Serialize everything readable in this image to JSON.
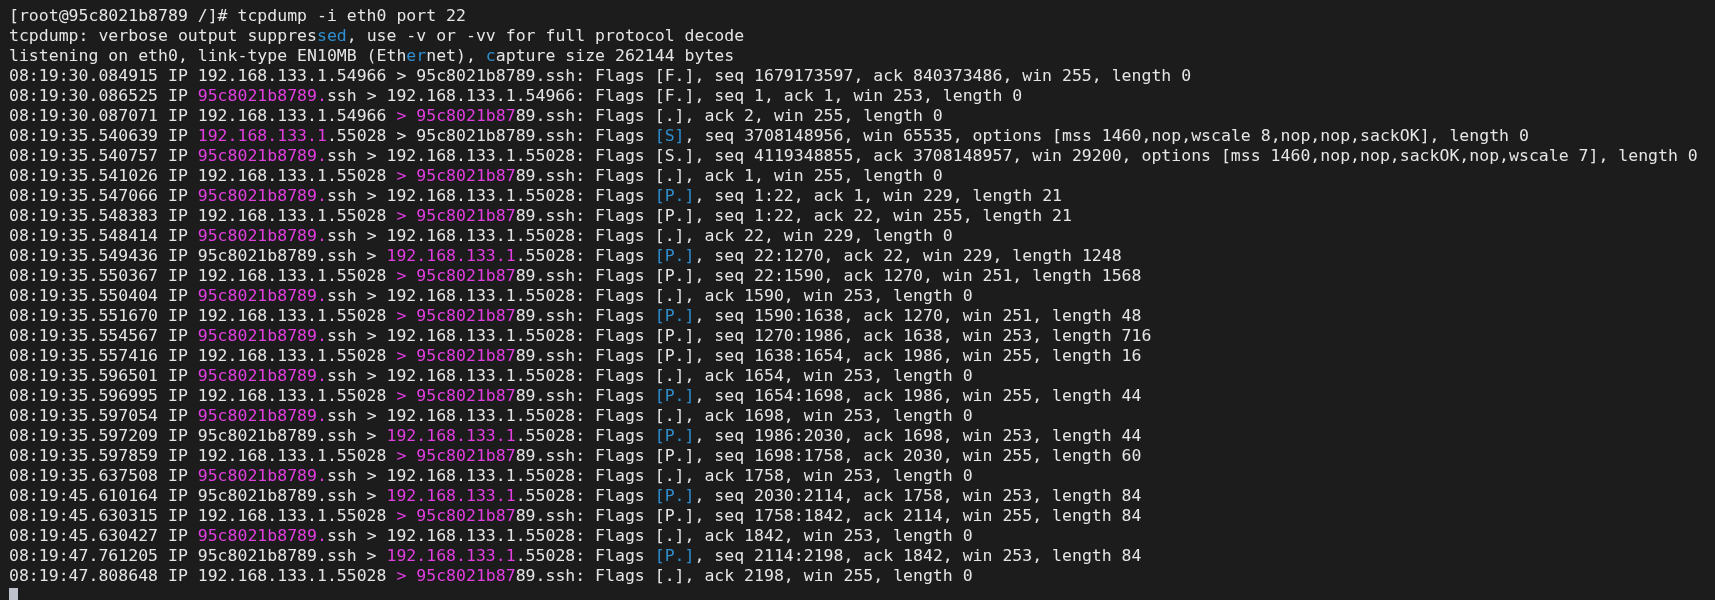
{
  "terminal": {
    "lines": [
      {
        "segments": [
          {
            "kind": "plain",
            "text": "[root@95c8021b8789 /]# tcpdump -i eth0 port 22"
          }
        ]
      },
      {
        "segments": [
          {
            "kind": "plain",
            "text": "tcpdump: verbose output suppres"
          },
          {
            "kind": "flag",
            "text": "sed"
          },
          {
            "kind": "plain",
            "text": ", use -v or -vv for full protocol decode"
          }
        ]
      },
      {
        "segments": [
          {
            "kind": "plain",
            "text": "listening on eth0, link-type EN10MB (Eth"
          },
          {
            "kind": "flag",
            "text": "er"
          },
          {
            "kind": "plain",
            "text": "net), "
          },
          {
            "kind": "flag",
            "text": "c"
          },
          {
            "kind": "plain",
            "text": "apture size 262144 bytes"
          }
        ]
      },
      {
        "segments": [
          {
            "kind": "plain",
            "text": "08:19:30.084915 IP 192.168.133.1.54966 > 95c8021b8789.ssh: Flags [F.], seq 1679173597, ack 840373486, win 255, length 0"
          }
        ]
      },
      {
        "segments": [
          {
            "kind": "plain",
            "text": "08:19:30.086525 IP "
          },
          {
            "kind": "match",
            "text": "95c8021b8789."
          },
          {
            "kind": "plain",
            "text": "ssh > 192.168.133.1.54966: Flags [F.], seq 1, ack 1, win 253, length 0"
          }
        ]
      },
      {
        "segments": [
          {
            "kind": "plain",
            "text": "08:19:30.087071 IP 192.168.133.1.54966 "
          },
          {
            "kind": "match",
            "text": "> 95c8021b87"
          },
          {
            "kind": "plain",
            "text": "89.ssh: Flags [.], ack 2, win 255, length 0"
          }
        ]
      },
      {
        "segments": [
          {
            "kind": "plain",
            "text": "08:19:35.540639 IP "
          },
          {
            "kind": "match",
            "text": "192.168.133.1"
          },
          {
            "kind": "plain",
            "text": ".55028 > 95c8021b8789.ssh: Flags "
          },
          {
            "kind": "flag",
            "text": "[S]"
          },
          {
            "kind": "plain",
            "text": ", seq 3708148956, win 65535, options [mss 1460,nop,wscale 8,nop,nop,sackOK], length 0"
          }
        ]
      },
      {
        "segments": [
          {
            "kind": "plain",
            "text": "08:19:35.540757 IP "
          },
          {
            "kind": "match",
            "text": "95c8021b8789."
          },
          {
            "kind": "plain",
            "text": "ssh > 192.168.133.1.55028: Flags [S.], seq 4119348855, ack 3708148957, win 29200, options [mss 1460,nop,nop,sackOK,nop,wscale 7], length 0"
          }
        ]
      },
      {
        "segments": [
          {
            "kind": "plain",
            "text": "08:19:35.541026 IP 192.168.133.1.55028 "
          },
          {
            "kind": "match",
            "text": "> 95c8021b87"
          },
          {
            "kind": "plain",
            "text": "89.ssh: Flags [.], ack 1, win 255, length 0"
          }
        ]
      },
      {
        "segments": [
          {
            "kind": "plain",
            "text": "08:19:35.547066 IP "
          },
          {
            "kind": "match",
            "text": "95c8021b8789."
          },
          {
            "kind": "plain",
            "text": "ssh > 192.168.133.1.55028: Flags "
          },
          {
            "kind": "flag",
            "text": "[P.]"
          },
          {
            "kind": "plain",
            "text": ", seq 1:22, ack 1, win 229, length 21"
          }
        ]
      },
      {
        "segments": [
          {
            "kind": "plain",
            "text": "08:19:35.548383 IP 192.168.133.1.55028 "
          },
          {
            "kind": "match",
            "text": "> 95c8021b87"
          },
          {
            "kind": "plain",
            "text": "89.ssh: Flags [P.], seq 1:22, ack 22, win 255, length 21"
          }
        ]
      },
      {
        "segments": [
          {
            "kind": "plain",
            "text": "08:19:35.548414 IP "
          },
          {
            "kind": "match",
            "text": "95c8021b8789."
          },
          {
            "kind": "plain",
            "text": "ssh > 192.168.133.1.55028: Flags [.], ack 22, win 229, length 0"
          }
        ]
      },
      {
        "segments": [
          {
            "kind": "plain",
            "text": "08:19:35.549436 IP 95c8021b8789.ssh > "
          },
          {
            "kind": "match",
            "text": "192.168.133.1"
          },
          {
            "kind": "plain",
            "text": ".55028: Flags "
          },
          {
            "kind": "flag",
            "text": "[P.]"
          },
          {
            "kind": "plain",
            "text": ", seq 22:1270, ack 22, win 229, length 1248"
          }
        ]
      },
      {
        "segments": [
          {
            "kind": "plain",
            "text": "08:19:35.550367 IP 192.168.133.1.55028 "
          },
          {
            "kind": "match",
            "text": "> 95c8021b87"
          },
          {
            "kind": "plain",
            "text": "89.ssh: Flags [P.], seq 22:1590, ack 1270, win 251, length 1568"
          }
        ]
      },
      {
        "segments": [
          {
            "kind": "plain",
            "text": "08:19:35.550404 IP "
          },
          {
            "kind": "match",
            "text": "95c8021b8789."
          },
          {
            "kind": "plain",
            "text": "ssh > 192.168.133.1.55028: Flags [.], ack 1590, win 253, length 0"
          }
        ]
      },
      {
        "segments": [
          {
            "kind": "plain",
            "text": "08:19:35.551670 IP 192.168.133.1.55028 "
          },
          {
            "kind": "match",
            "text": "> 95c8021b87"
          },
          {
            "kind": "plain",
            "text": "89.ssh: Flags "
          },
          {
            "kind": "flag",
            "text": "[P.]"
          },
          {
            "kind": "plain",
            "text": ", seq 1590:1638, ack 1270, win 251, length 48"
          }
        ]
      },
      {
        "segments": [
          {
            "kind": "plain",
            "text": "08:19:35.554567 IP "
          },
          {
            "kind": "match",
            "text": "95c8021b8789."
          },
          {
            "kind": "plain",
            "text": "ssh > 192.168.133.1.55028: Flags [P.], seq 1270:1986, ack 1638, win 253, length 716"
          }
        ]
      },
      {
        "segments": [
          {
            "kind": "plain",
            "text": "08:19:35.557416 IP 192.168.133.1.55028 "
          },
          {
            "kind": "match",
            "text": "> 95c8021b87"
          },
          {
            "kind": "plain",
            "text": "89.ssh: Flags [P.], seq 1638:1654, ack 1986, win 255, length 16"
          }
        ]
      },
      {
        "segments": [
          {
            "kind": "plain",
            "text": "08:19:35.596501 IP "
          },
          {
            "kind": "match",
            "text": "95c8021b8789."
          },
          {
            "kind": "plain",
            "text": "ssh > 192.168.133.1.55028: Flags [.], ack 1654, win 253, length 0"
          }
        ]
      },
      {
        "segments": [
          {
            "kind": "plain",
            "text": "08:19:35.596995 IP 192.168.133.1.55028 "
          },
          {
            "kind": "match",
            "text": "> 95c8021b87"
          },
          {
            "kind": "plain",
            "text": "89.ssh: Flags "
          },
          {
            "kind": "flag",
            "text": "[P.]"
          },
          {
            "kind": "plain",
            "text": ", seq 1654:1698, ack 1986, win 255, length 44"
          }
        ]
      },
      {
        "segments": [
          {
            "kind": "plain",
            "text": "08:19:35.597054 IP "
          },
          {
            "kind": "match",
            "text": "95c8021b8789."
          },
          {
            "kind": "plain",
            "text": "ssh > 192.168.133.1.55028: Flags [.], ack 1698, win 253, length 0"
          }
        ]
      },
      {
        "segments": [
          {
            "kind": "plain",
            "text": "08:19:35.597209 IP 95c8021b8789.ssh > "
          },
          {
            "kind": "match",
            "text": "192.168.133.1"
          },
          {
            "kind": "plain",
            "text": ".55028: Flags "
          },
          {
            "kind": "flag",
            "text": "[P.]"
          },
          {
            "kind": "plain",
            "text": ", seq 1986:2030, ack 1698, win 253, length 44"
          }
        ]
      },
      {
        "segments": [
          {
            "kind": "plain",
            "text": "08:19:35.597859 IP 192.168.133.1.55028 "
          },
          {
            "kind": "match",
            "text": "> 95c8021b87"
          },
          {
            "kind": "plain",
            "text": "89.ssh: Flags [P.], seq 1698:1758, ack 2030, win 255, length 60"
          }
        ]
      },
      {
        "segments": [
          {
            "kind": "plain",
            "text": "08:19:35.637508 IP "
          },
          {
            "kind": "match",
            "text": "95c8021b8789."
          },
          {
            "kind": "plain",
            "text": "ssh > 192.168.133.1.55028: Flags [.], ack 1758, win 253, length 0"
          }
        ]
      },
      {
        "segments": [
          {
            "kind": "plain",
            "text": "08:19:45.610164 IP 95c8021b8789.ssh > "
          },
          {
            "kind": "match",
            "text": "192.168.133.1"
          },
          {
            "kind": "plain",
            "text": ".55028: Flags "
          },
          {
            "kind": "flag",
            "text": "[P.]"
          },
          {
            "kind": "plain",
            "text": ", seq 2030:2114, ack 1758, win 253, length 84"
          }
        ]
      },
      {
        "segments": [
          {
            "kind": "plain",
            "text": "08:19:45.630315 IP 192.168.133.1.55028 "
          },
          {
            "kind": "match",
            "text": "> 95c8021b87"
          },
          {
            "kind": "plain",
            "text": "89.ssh: Flags [P.], seq 1758:1842, ack 2114, win 255, length 84"
          }
        ]
      },
      {
        "segments": [
          {
            "kind": "plain",
            "text": "08:19:45.630427 IP "
          },
          {
            "kind": "match",
            "text": "95c8021b8789."
          },
          {
            "kind": "plain",
            "text": "ssh > 192.168.133.1.55028: Flags [.], ack 1842, win 253, length 0"
          }
        ]
      },
      {
        "segments": [
          {
            "kind": "plain",
            "text": "08:19:47.761205 IP 95c8021b8789.ssh > "
          },
          {
            "kind": "match",
            "text": "192.168.133.1"
          },
          {
            "kind": "plain",
            "text": ".55028: Flags "
          },
          {
            "kind": "flag",
            "text": "[P.]"
          },
          {
            "kind": "plain",
            "text": ", seq 2114:2198, ack 1842, win 253, length 84"
          }
        ]
      },
      {
        "segments": [
          {
            "kind": "plain",
            "text": "08:19:47.808648 IP 192.168.133.1.55028 "
          },
          {
            "kind": "match",
            "text": "> 95c8021b87"
          },
          {
            "kind": "plain",
            "text": "89.ssh: Flags [.], ack 2198, win 255, length 0"
          }
        ]
      }
    ]
  }
}
